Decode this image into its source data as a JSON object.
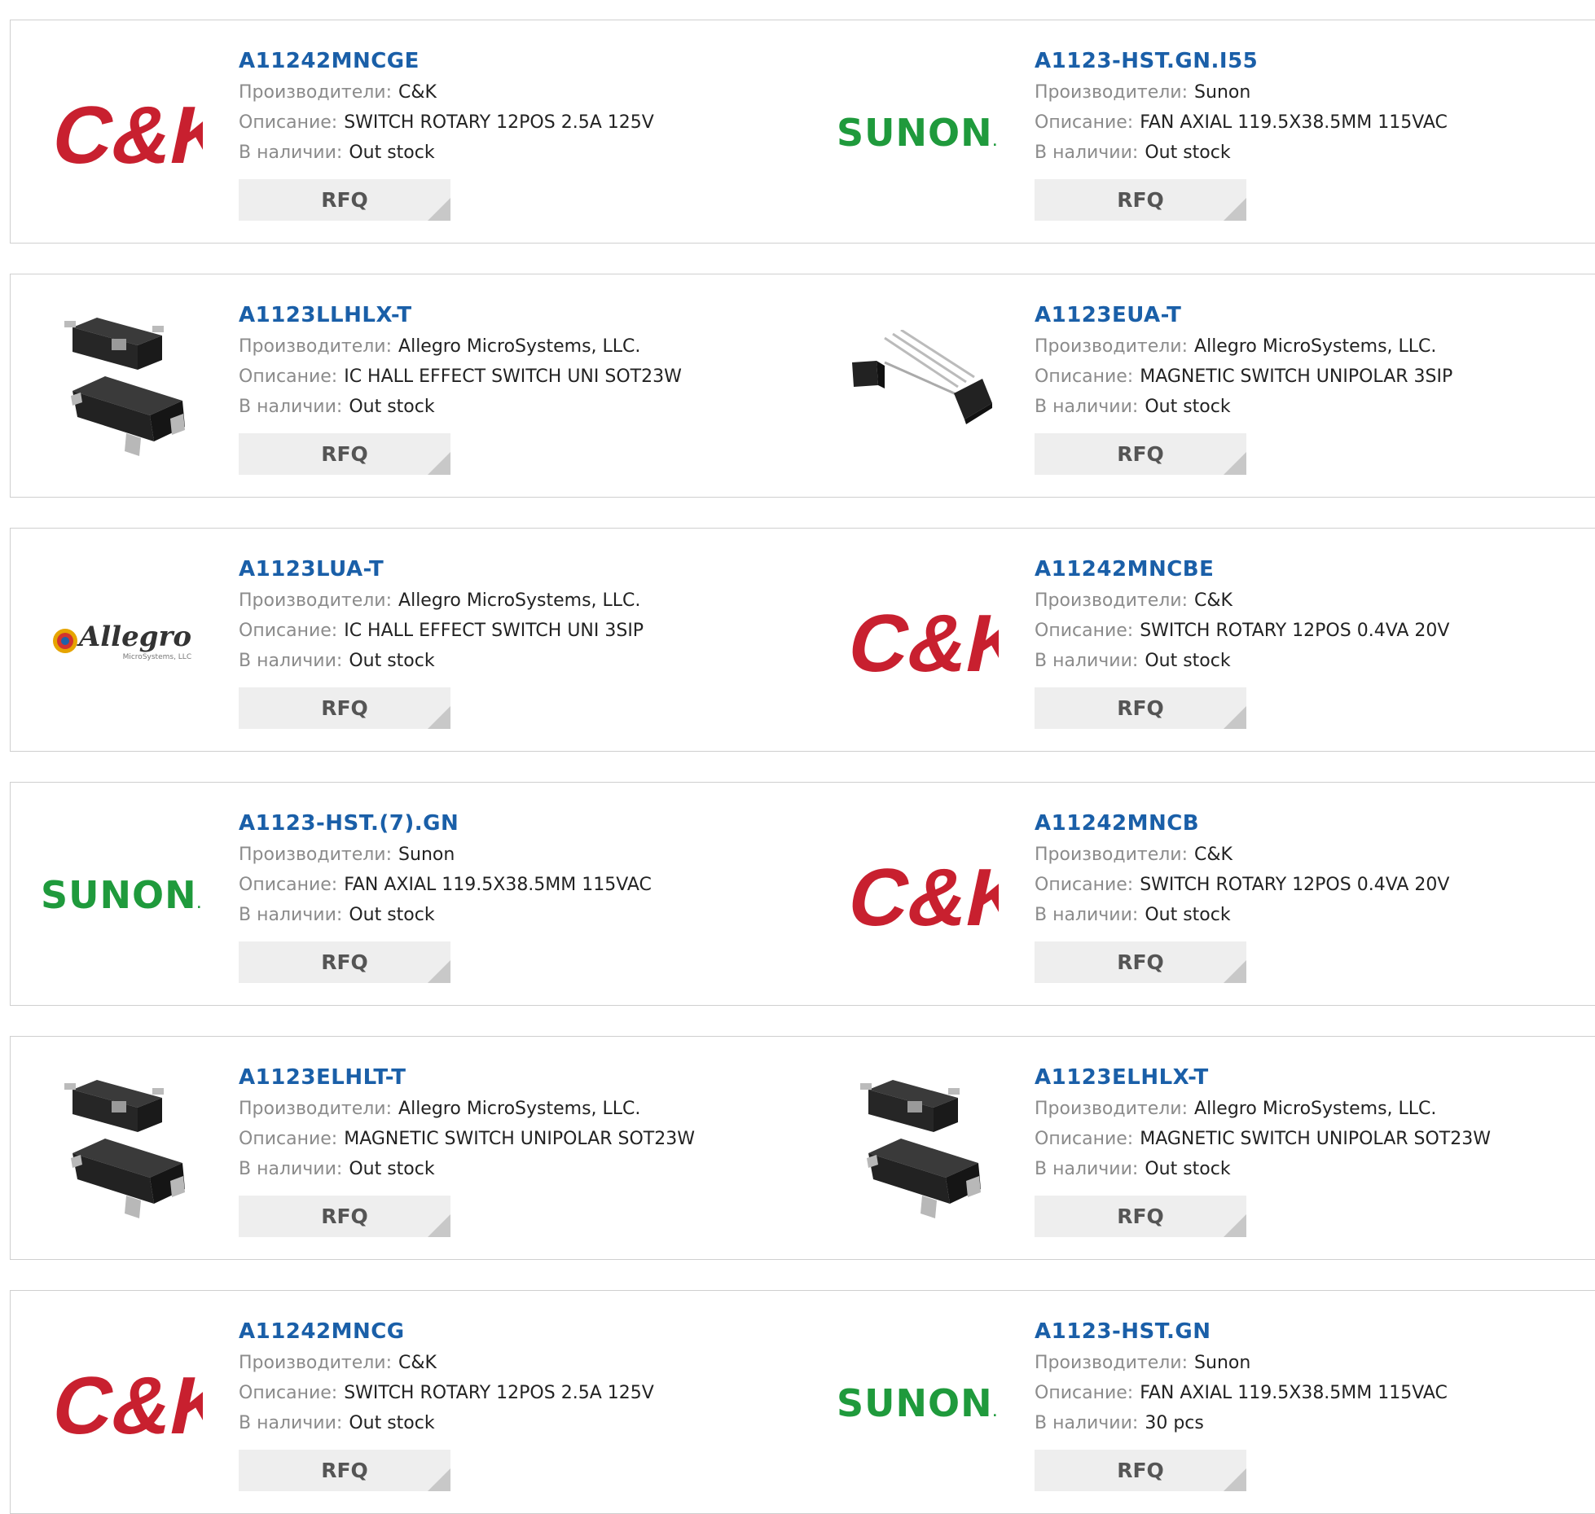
{
  "labels": {
    "manufacturer": "Производители:",
    "description": "Описание:",
    "stock": "В наличии:",
    "rfq": "RFQ"
  },
  "logos": {
    "ck_text": "C&K",
    "sunon_text": "SUNON",
    "sunon_dot": ".",
    "allegro_text": "Allegro",
    "allegro_sub": "MicroSystems, LLC"
  },
  "products": [
    {
      "part": "A11242MNCGE",
      "manufacturer": "C&K",
      "description": "SWITCH ROTARY 12POS 2.5A 125V",
      "stock": "Out stock",
      "logo": "ck"
    },
    {
      "part": "A1123-HST.GN.I55",
      "manufacturer": "Sunon",
      "description": "FAN AXIAL 119.5X38.5MM 115VAC",
      "stock": "Out stock",
      "logo": "sunon"
    },
    {
      "part": "A1123LLHLX-T",
      "manufacturer": "Allegro MicroSystems, LLC.",
      "description": "IC HALL EFFECT SWITCH UNI SOT23W",
      "stock": "Out stock",
      "logo": "sot23"
    },
    {
      "part": "A1123EUA-T",
      "manufacturer": "Allegro MicroSystems, LLC.",
      "description": "MAGNETIC SWITCH UNIPOLAR 3SIP",
      "stock": "Out stock",
      "logo": "sip"
    },
    {
      "part": "A1123LUA-T",
      "manufacturer": "Allegro MicroSystems, LLC.",
      "description": "IC HALL EFFECT SWITCH UNI 3SIP",
      "stock": "Out stock",
      "logo": "allegro"
    },
    {
      "part": "A11242MNCBE",
      "manufacturer": "C&K",
      "description": "SWITCH ROTARY 12POS 0.4VA 20V",
      "stock": "Out stock",
      "logo": "ck"
    },
    {
      "part": "A1123-HST.(7).GN",
      "manufacturer": "Sunon",
      "description": "FAN AXIAL 119.5X38.5MM 115VAC",
      "stock": "Out stock",
      "logo": "sunon"
    },
    {
      "part": "A11242MNCB",
      "manufacturer": "C&K",
      "description": "SWITCH ROTARY 12POS 0.4VA 20V",
      "stock": "Out stock",
      "logo": "ck"
    },
    {
      "part": "A1123ELHLT-T",
      "manufacturer": "Allegro MicroSystems, LLC.",
      "description": "MAGNETIC SWITCH UNIPOLAR SOT23W",
      "stock": "Out stock",
      "logo": "sot23"
    },
    {
      "part": "A1123ELHLX-T",
      "manufacturer": "Allegro MicroSystems, LLC.",
      "description": "MAGNETIC SWITCH UNIPOLAR SOT23W",
      "stock": "Out stock",
      "logo": "sot23"
    },
    {
      "part": "A11242MNCG",
      "manufacturer": "C&K",
      "description": "SWITCH ROTARY 12POS 2.5A 125V",
      "stock": "Out stock",
      "logo": "ck"
    },
    {
      "part": "A1123-HST.GN",
      "manufacturer": "Sunon",
      "description": "FAN AXIAL 119.5X38.5MM 115VAC",
      "stock": "30 pcs",
      "logo": "sunon"
    }
  ]
}
